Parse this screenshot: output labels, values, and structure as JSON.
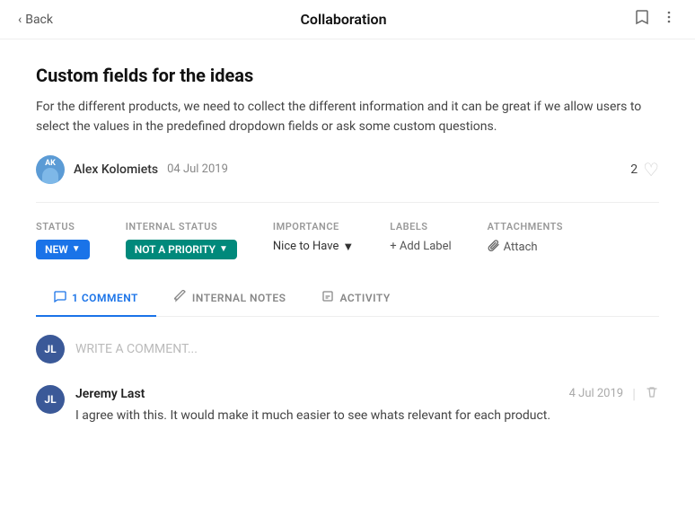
{
  "header": {
    "back_label": "Back",
    "title": "Collaboration",
    "bookmark_icon": "🔖",
    "more_icon": "⋮"
  },
  "idea": {
    "title": "Custom fields for the ideas",
    "description": "For the different products, we need to collect the different information and it can be great if we allow users to select the values in the predefined dropdown fields or ask some custom questions.",
    "author_name": "Alex Kolomiets",
    "author_date": "04 Jul 2019",
    "like_count": "2"
  },
  "fields": {
    "status_label": "STATUS",
    "status_value": "NEW",
    "internal_status_label": "INTERNAL STATUS",
    "internal_status_value": "NOT A PRIORITY",
    "importance_label": "IMPORTANCE",
    "importance_value": "Nice to Have",
    "labels_label": "LABELS",
    "labels_add": "+ Add Label",
    "attachments_label": "ATTACHMENTS",
    "attach_label": "Attach"
  },
  "tabs": [
    {
      "id": "comments",
      "label": "1 COMMENT",
      "icon": "💬",
      "active": true
    },
    {
      "id": "internal_notes",
      "label": "INTERNAL NOTES",
      "icon": "✏️",
      "active": false
    },
    {
      "id": "activity",
      "label": "ACTIVITY",
      "icon": "📊",
      "active": false
    }
  ],
  "comment_input": {
    "placeholder": "WRITE A COMMENT...",
    "user_initials": "JL"
  },
  "comments": [
    {
      "author": "Jeremy Last",
      "date": "4 Jul 2019",
      "text": "I agree with this. It would make it much easier to see whats relevant for each product.",
      "initials": "JL"
    }
  ]
}
